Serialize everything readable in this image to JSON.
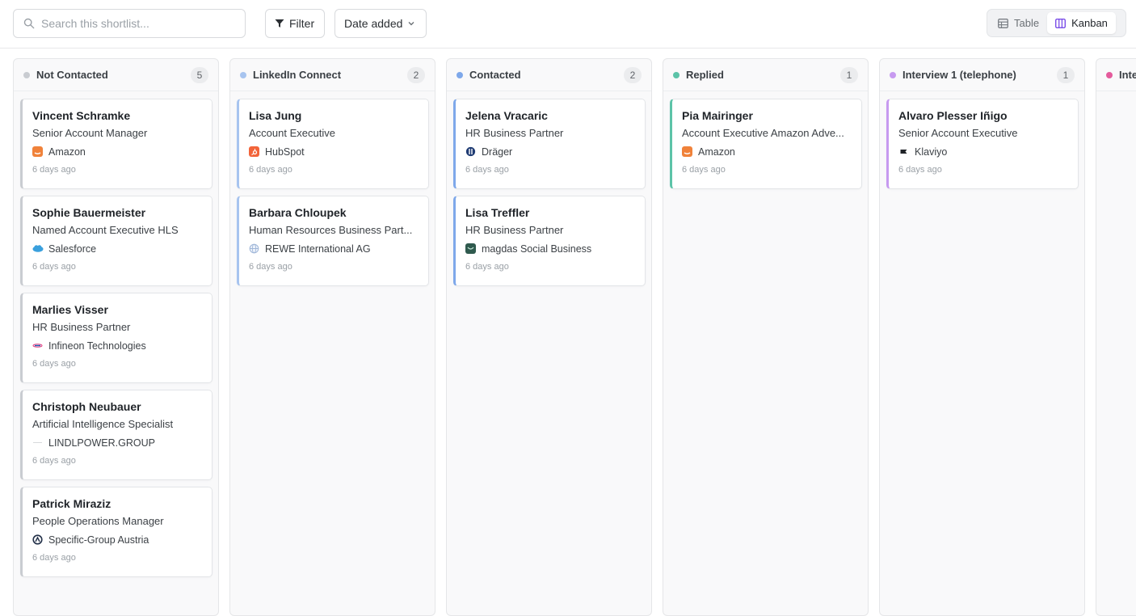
{
  "toolbar": {
    "search_placeholder": "Search this shortlist...",
    "filter_label": "Filter",
    "sort_label": "Date added",
    "views": {
      "table": "Table",
      "kanban": "Kanban",
      "active": "kanban"
    }
  },
  "colors": {
    "not_contacted": "#c9ccd1",
    "linkedin_connect": "#a7c4ef",
    "contacted": "#7ea8ea",
    "replied": "#5cc3a8",
    "interview_1": "#c79af0",
    "next": "#e45b9c"
  },
  "columns": [
    {
      "title": "Not Contacted",
      "count": "5",
      "color": "#c9ccd1",
      "cards": [
        {
          "name": "Vincent Schramke",
          "role": "Senior Account Manager",
          "company": "Amazon",
          "logo": "amazon-icon",
          "time": "6 days ago"
        },
        {
          "name": "Sophie Bauermeister",
          "role": "Named Account Executive HLS",
          "company": "Salesforce",
          "logo": "salesforce-icon",
          "time": "6 days ago"
        },
        {
          "name": "Marlies Visser",
          "role": "HR Business Partner",
          "company": "Infineon Technologies",
          "logo": "infineon-icon",
          "time": "6 days ago"
        },
        {
          "name": "Christoph Neubauer",
          "role": "Artificial Intelligence Specialist",
          "company": "LINDLPOWER.GROUP",
          "logo": "lindlpower-icon",
          "time": "6 days ago"
        },
        {
          "name": "Patrick Miraziz",
          "role": "People Operations Manager",
          "company": "Specific-Group Austria",
          "logo": "specific-group-icon",
          "time": "6 days ago"
        }
      ]
    },
    {
      "title": "LinkedIn Connect",
      "count": "2",
      "color": "#a7c4ef",
      "cards": [
        {
          "name": "Lisa Jung",
          "role": "Account Executive",
          "company": "HubSpot",
          "logo": "hubspot-icon",
          "time": "6 days ago"
        },
        {
          "name": "Barbara Chloupek",
          "role": "Human Resources Business Part...",
          "company": "REWE International AG",
          "logo": "globe-icon",
          "time": "6 days ago"
        }
      ]
    },
    {
      "title": "Contacted",
      "count": "2",
      "color": "#7ea8ea",
      "cards": [
        {
          "name": "Jelena Vracaric",
          "role": "HR Business Partner",
          "company": "Dräger",
          "logo": "draeger-icon",
          "time": "6 days ago"
        },
        {
          "name": "Lisa Treffler",
          "role": "HR Business Partner",
          "company": "magdas Social Business",
          "logo": "magdas-icon",
          "time": "6 days ago"
        }
      ]
    },
    {
      "title": "Replied",
      "count": "1",
      "color": "#5cc3a8",
      "cards": [
        {
          "name": "Pia Mairinger",
          "role": "Account Executive Amazon Adve...",
          "company": "Amazon",
          "logo": "amazon-icon",
          "time": "6 days ago"
        }
      ]
    },
    {
      "title": "Interview 1 (telephone)",
      "count": "1",
      "color": "#c79af0",
      "cards": [
        {
          "name": "Alvaro Plesser Iñigo",
          "role": "Senior Account Executive",
          "company": "Klaviyo",
          "logo": "klaviyo-icon",
          "time": "6 days ago"
        }
      ]
    },
    {
      "title": "Inte",
      "color": "#e45b9c"
    }
  ]
}
